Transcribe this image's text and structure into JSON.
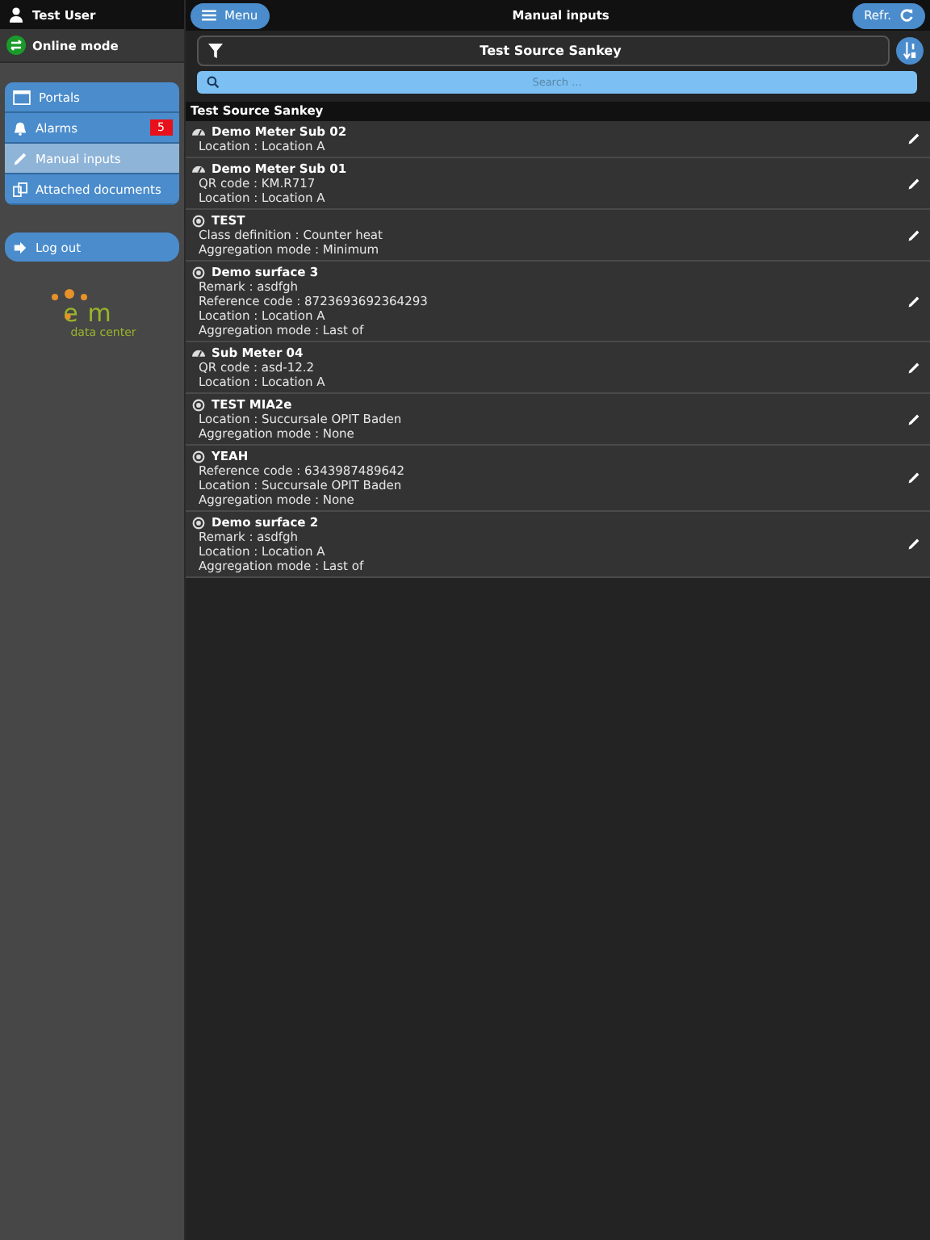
{
  "user": {
    "name": "Test User"
  },
  "mode": {
    "label": "Online mode"
  },
  "menu": [
    {
      "label": "Portals",
      "selected": false
    },
    {
      "label": "Alarms",
      "selected": false,
      "badge": "5"
    },
    {
      "label": "Manual inputs",
      "selected": true
    },
    {
      "label": "Attached documents",
      "selected": false
    }
  ],
  "logout": {
    "label": "Log out"
  },
  "logo": {
    "left": "e",
    "right": "m",
    "caption": "data center"
  },
  "header": {
    "menu_button": "Menu",
    "title": "Manual inputs",
    "refresh_button": "Refr."
  },
  "filter": {
    "value": "Test Source Sankey"
  },
  "search": {
    "placeholder": "Search ..."
  },
  "section": {
    "title": "Test Source Sankey"
  },
  "items": [
    {
      "kind": "meter",
      "title": "Demo Meter Sub 02",
      "lines": [
        "Location : Location A"
      ]
    },
    {
      "kind": "meter",
      "title": "Demo Meter Sub 01",
      "lines": [
        "QR code : KM.R717",
        "Location : Location A"
      ]
    },
    {
      "kind": "surface",
      "title": "TEST",
      "lines": [
        "Class definition : Counter heat",
        "Aggregation mode : Minimum"
      ]
    },
    {
      "kind": "surface",
      "title": "Demo surface 3",
      "lines": [
        "Remark : asdfgh",
        "Reference code : 8723693692364293",
        "Location : Location A",
        "Aggregation mode : Last of"
      ]
    },
    {
      "kind": "meter",
      "title": "Sub Meter 04",
      "lines": [
        "QR code : asd-12.2",
        "Location : Location A"
      ]
    },
    {
      "kind": "surface",
      "title": "TEST MIA2e",
      "lines": [
        "Location : Succursale OPIT Baden",
        "Aggregation mode : None"
      ]
    },
    {
      "kind": "surface",
      "title": "YEAH",
      "lines": [
        "Reference code : 6343987489642",
        "Location : Succursale OPIT Baden",
        "Aggregation mode : None"
      ]
    },
    {
      "kind": "surface",
      "title": "Demo surface 2",
      "lines": [
        "Remark : asdfgh",
        "Location : Location A",
        "Aggregation mode : Last of"
      ]
    }
  ]
}
